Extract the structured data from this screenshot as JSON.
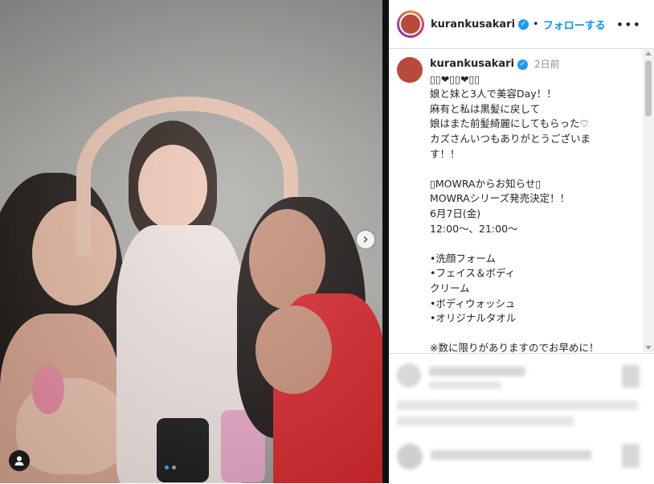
{
  "header": {
    "username": "kurankusakari",
    "separator": "•",
    "follow_label": "フォローする",
    "more_icon": "•••"
  },
  "caption": {
    "username": "kurankusakari",
    "time": "2日前",
    "lines": [
      "▯▯❤▯▯❤▯▯",
      "娘と妹と3人で美容Day！！",
      "麻有と私は黒髪に戻して",
      "娘はまた前髪綺麗にしてもらった♡",
      "カズさんいつもありがとうございま",
      "す！！",
      "",
      "▯MOWRAからお知らせ▯",
      "MOWRAシリーズ発売決定！！",
      "6月7日(金)",
      "12:00〜、21:00〜",
      "",
      "•洗顔フォーム",
      "•フェイス＆ボディ",
      "クリーム",
      "•ボディウォッシュ",
      "•オリジナルタオル",
      "",
      "※数に限りがありますのでお早めに！"
    ]
  },
  "icons": {
    "verified": "✓",
    "next": "›",
    "user_tag": "user-tag-icon"
  },
  "colors": {
    "accent": "#0095f6",
    "verified": "#1d9bf0"
  }
}
